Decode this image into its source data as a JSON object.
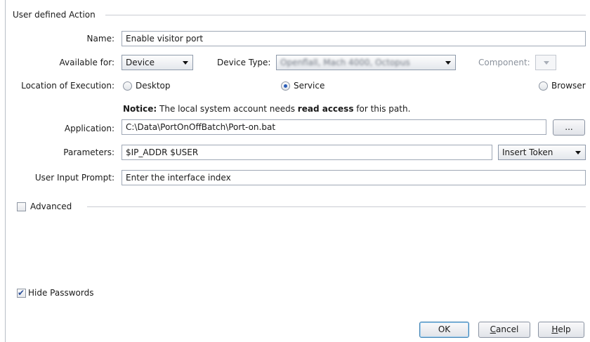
{
  "section_user_action": {
    "title": "User defined Action"
  },
  "name": {
    "label": "Name:",
    "value": "Enable visitor port"
  },
  "available_for": {
    "label": "Available for:",
    "value": "Device"
  },
  "device_type": {
    "label": "Device Type:",
    "value": "Openflall, Mach 4000, Octopus"
  },
  "component": {
    "label": "Component:"
  },
  "location": {
    "label": "Location of Execution:",
    "options": [
      {
        "label": "Desktop",
        "checked": false
      },
      {
        "label": "Service",
        "checked": true
      },
      {
        "label": "Browser",
        "checked": false
      }
    ]
  },
  "notice": {
    "prefix": "Notice:",
    "middle": " The local system account needs ",
    "bold": "read access",
    "suffix": " for this path."
  },
  "application": {
    "label": "Application:",
    "value": "C:\\Data\\PortOnOffBatch\\Port-on.bat",
    "browse_label": "..."
  },
  "parameters": {
    "label": "Parameters:",
    "value": "$IP_ADDR $USER",
    "insert_token_label": "Insert Token"
  },
  "user_input_prompt": {
    "label": "User Input Prompt:",
    "value": "Enter the interface index"
  },
  "advanced": {
    "label": "Advanced",
    "checked": false
  },
  "hide_passwords": {
    "label": "Hide Passwords",
    "checked": true
  },
  "buttons": {
    "ok": "OK",
    "cancel_first": "C",
    "cancel_rest": "ancel",
    "help_first": "H",
    "help_rest": "elp"
  }
}
